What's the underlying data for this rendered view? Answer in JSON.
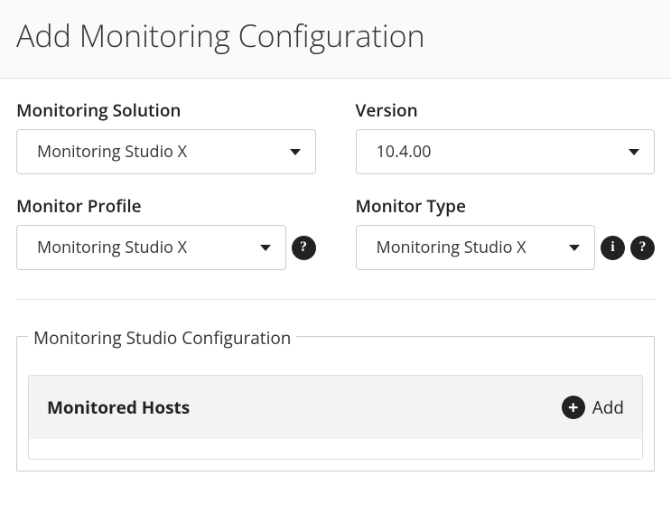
{
  "header": {
    "title": "Add Monitoring Configuration"
  },
  "fields": {
    "solution": {
      "label": "Monitoring Solution",
      "value": "Monitoring Studio X"
    },
    "version": {
      "label": "Version",
      "value": "10.4.00"
    },
    "profile": {
      "label": "Monitor Profile",
      "value": "Monitoring Studio X"
    },
    "type": {
      "label": "Monitor Type",
      "value": "Monitoring Studio X"
    }
  },
  "config": {
    "legend": "Monitoring Studio Configuration",
    "hosts": {
      "title": "Monitored Hosts",
      "add_label": "Add"
    }
  },
  "icons": {
    "help": "?",
    "info": "i",
    "plus": "+"
  }
}
